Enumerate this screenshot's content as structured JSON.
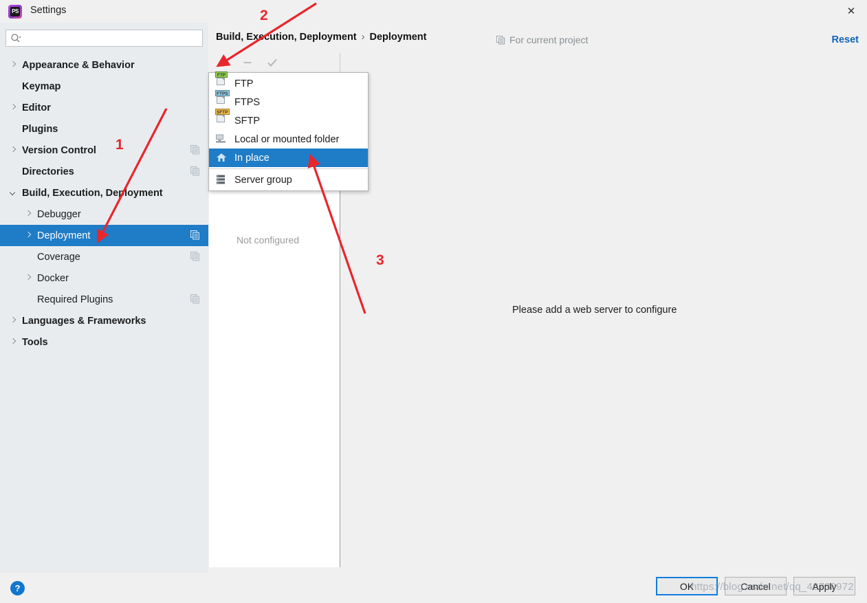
{
  "window": {
    "title": "Settings",
    "app_icon": "phpstorm-logo",
    "close_label": "✕"
  },
  "search": {
    "value": "",
    "placeholder": ""
  },
  "sidebar": {
    "items": [
      {
        "label": "Appearance & Behavior",
        "indent": 0,
        "arrow": "closed",
        "bold": true,
        "selected": false,
        "copy_icon": false
      },
      {
        "label": "Keymap",
        "indent": 0,
        "arrow": "none",
        "bold": true,
        "selected": false,
        "copy_icon": false
      },
      {
        "label": "Editor",
        "indent": 0,
        "arrow": "closed",
        "bold": true,
        "selected": false,
        "copy_icon": false
      },
      {
        "label": "Plugins",
        "indent": 0,
        "arrow": "none",
        "bold": true,
        "selected": false,
        "copy_icon": false
      },
      {
        "label": "Version Control",
        "indent": 0,
        "arrow": "closed",
        "bold": true,
        "selected": false,
        "copy_icon": true
      },
      {
        "label": "Directories",
        "indent": 0,
        "arrow": "none",
        "bold": true,
        "selected": false,
        "copy_icon": true
      },
      {
        "label": "Build, Execution, Deployment",
        "indent": 0,
        "arrow": "open",
        "bold": true,
        "selected": false,
        "copy_icon": false
      },
      {
        "label": "Debugger",
        "indent": 1,
        "arrow": "closed",
        "bold": false,
        "selected": false,
        "copy_icon": false
      },
      {
        "label": "Deployment",
        "indent": 1,
        "arrow": "closed",
        "bold": false,
        "selected": true,
        "copy_icon": true
      },
      {
        "label": "Coverage",
        "indent": 1,
        "arrow": "none",
        "bold": false,
        "selected": false,
        "copy_icon": true
      },
      {
        "label": "Docker",
        "indent": 1,
        "arrow": "closed",
        "bold": false,
        "selected": false,
        "copy_icon": false
      },
      {
        "label": "Required Plugins",
        "indent": 1,
        "arrow": "none",
        "bold": false,
        "selected": false,
        "copy_icon": true
      },
      {
        "label": "Languages & Frameworks",
        "indent": 0,
        "arrow": "closed",
        "bold": true,
        "selected": false,
        "copy_icon": false
      },
      {
        "label": "Tools",
        "indent": 0,
        "arrow": "closed",
        "bold": true,
        "selected": false,
        "copy_icon": false
      }
    ]
  },
  "header": {
    "breadcrumb_parent": "Build, Execution, Deployment",
    "breadcrumb_sep": "›",
    "breadcrumb_current": "Deployment",
    "for_project": "For current project",
    "reset": "Reset"
  },
  "toolbar": {
    "add_label": "+",
    "remove_label": "−",
    "default_label": "✓"
  },
  "list_panel": {
    "empty_text": "Not configured"
  },
  "detail_panel": {
    "message": "Please add a web server to configure"
  },
  "popup": {
    "items": [
      {
        "label": "FTP",
        "icon": "ftp-icon",
        "tag": "FTP",
        "tag_color": "#92d14f",
        "selected": false,
        "separator_after": false
      },
      {
        "label": "FTPS",
        "icon": "ftps-icon",
        "tag": "FTPS",
        "tag_color": "#8ecae6",
        "selected": false,
        "separator_after": false
      },
      {
        "label": "SFTP",
        "icon": "sftp-icon",
        "tag": "SFTP",
        "tag_color": "#f3bd4a",
        "selected": false,
        "separator_after": false
      },
      {
        "label": "Local or mounted folder",
        "icon": "local-folder-icon",
        "tag": "",
        "tag_color": "",
        "selected": false,
        "separator_after": false
      },
      {
        "label": "In place",
        "icon": "in-place-home-icon",
        "tag": "",
        "tag_color": "",
        "selected": true,
        "separator_after": true
      },
      {
        "label": "Server group",
        "icon": "server-group-icon",
        "tag": "",
        "tag_color": "",
        "selected": false,
        "separator_after": false
      }
    ]
  },
  "footer": {
    "help": "?",
    "ok": "OK",
    "cancel": "Cancel",
    "apply": "Apply"
  },
  "annotations": {
    "numbers": [
      "1",
      "2",
      "3"
    ],
    "color": "#e8262b",
    "watermark": "https://blog.csdn.net/qq_40730972"
  }
}
